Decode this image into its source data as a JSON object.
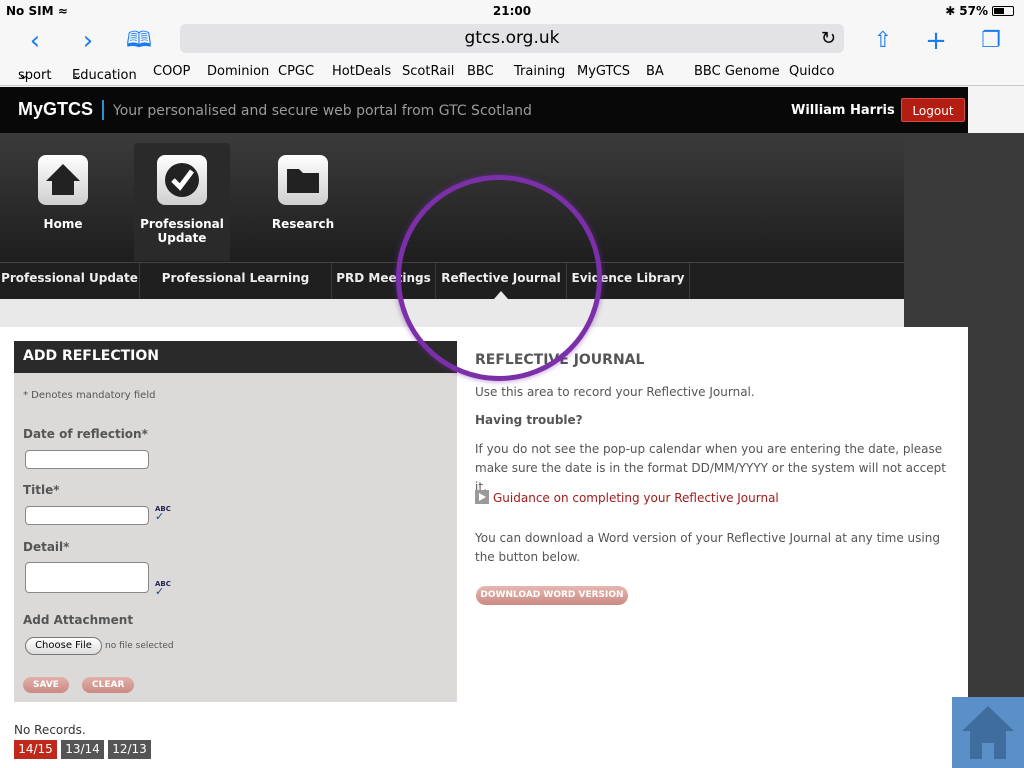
{
  "status": {
    "carrier": "No SIM",
    "time": "21:00",
    "battery": "57%",
    "battery_level": 0.57
  },
  "toolbar": {
    "url": "gtcs.org.uk"
  },
  "bookmarks": [
    "sport",
    "Education",
    "COOP",
    "Dominion",
    "CPGC",
    "HotDeals",
    "ScotRail",
    "BBC",
    "Training",
    "MyGTCS",
    "BA",
    "BBC Genome",
    "Quidco"
  ],
  "header": {
    "logo": "MyGTCS",
    "tagline": "Your personalised and secure web portal from GTC Scotland",
    "user": "William Harris",
    "logout": "Logout"
  },
  "icon_nav": [
    {
      "label": "Home",
      "icon": "house-icon"
    },
    {
      "label": "Professional Update",
      "icon": "checkmark-icon",
      "active": true
    },
    {
      "label": "Research",
      "icon": "folder-icon"
    }
  ],
  "sub_nav": [
    "Professional Update",
    "Professional Learning Record",
    "PRD Meetings",
    "Reflective Journal",
    "Evidence Library"
  ],
  "sub_nav_active": "Reflective Journal",
  "form": {
    "title": "ADD REFLECTION",
    "mandatory_note": "* Denotes mandatory field",
    "date_label": "Date of reflection*",
    "title_label": "Title*",
    "detail_label": "Detail*",
    "attachment_label": "Add Attachment",
    "choose_file": "Choose File",
    "no_file": "no file selected",
    "spell_text": "ABC",
    "save": "SAVE",
    "clear": "CLEAR"
  },
  "info": {
    "heading": "REFLECTIVE JOURNAL",
    "intro": "Use this area to record your Reflective Journal.",
    "trouble_heading": "Having trouble?",
    "trouble_text": "If you do not see the pop-up calendar when you are entering the date, please make sure the date is in the format DD/MM/YYYY or the system will not accept it.",
    "guidance_link": "Guidance on completing your Reflective Journal",
    "download_text": "You can download a Word version of your Reflective Journal at any time using the button below.",
    "download_button": "DOWNLOAD WORD VERSION"
  },
  "records": {
    "empty": "No Records.",
    "years": [
      {
        "label": "14/15",
        "color": "#c0281c"
      },
      {
        "label": "13/14",
        "color": "#555555"
      },
      {
        "label": "12/13",
        "color": "#555555"
      }
    ]
  },
  "colors": {
    "accent_red": "#b41e12",
    "highlight_circle": "#7b2fa8",
    "link_red": "#a31b1b"
  }
}
